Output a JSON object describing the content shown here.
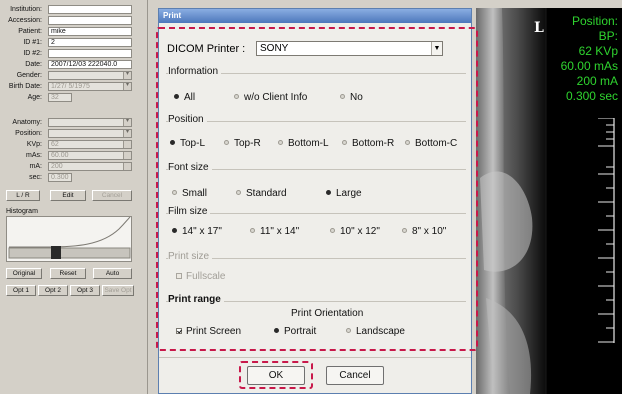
{
  "patient_panel": {
    "fields": [
      {
        "label": "Institution:",
        "value": ""
      },
      {
        "label": "Accession:",
        "value": ""
      },
      {
        "label": "Patient:",
        "value": "mike"
      },
      {
        "label": "ID #1:",
        "value": "2"
      },
      {
        "label": "ID #2:",
        "value": ""
      },
      {
        "label": "Date:",
        "value": "2007/12/03 222040.0"
      },
      {
        "label": "Gender:",
        "value": ""
      },
      {
        "label": "Birth Date:",
        "value": "1/27/ 5/1975"
      },
      {
        "label": "Age:",
        "value": "32"
      },
      {
        "label": "Anatomy:",
        "value": ""
      },
      {
        "label": "Position:",
        "value": ""
      },
      {
        "label": "KVp:",
        "value": "62"
      },
      {
        "label": "mAs:",
        "value": "60.00"
      },
      {
        "label": "mA:",
        "value": "200"
      },
      {
        "label": "sec:",
        "value": "0.300"
      }
    ],
    "buttons_row1": [
      "L / R",
      "Edit",
      "Cancel"
    ],
    "histogram_label": "Histogram",
    "buttons_row2": [
      "Original",
      "Reset",
      "Auto"
    ],
    "buttons_row3": [
      "Opt 1",
      "Opt 2",
      "Opt 3",
      "Save Opt"
    ]
  },
  "image_overlay": {
    "orientation_marker": "L",
    "lines": [
      "Position:",
      "BP:",
      "62 KVp",
      "60.00 mAs",
      "200 mA",
      "0.300 sec"
    ],
    "text_color": "#2fd42f"
  },
  "dialog": {
    "title": "Print",
    "printer_label": "DICOM Printer :",
    "printer_value": "SONY",
    "information": {
      "title": "Information",
      "options": [
        "All",
        "w/o Client Info",
        "No"
      ],
      "selected": "All"
    },
    "position": {
      "title": "Position",
      "options": [
        "Top-L",
        "Top-R",
        "Bottom-L",
        "Bottom-R",
        "Bottom-C"
      ],
      "selected": "Top-L"
    },
    "font_size": {
      "title": "Font size",
      "options": [
        "Small",
        "Standard",
        "Large"
      ],
      "selected": "Large"
    },
    "film_size": {
      "title": "Film size",
      "options": [
        "14\" x 17\"",
        "11\" x 14\"",
        "10\" x 12\"",
        "8\" x 10\""
      ],
      "selected": "14\" x 17\""
    },
    "print_size": {
      "title": "Print size",
      "checkbox": "Fullscale",
      "enabled": false
    },
    "print_range": {
      "title": "Print range",
      "checkbox": "Print Screen",
      "checked": true
    },
    "print_orientation": {
      "title": "Print Orientation",
      "options": [
        "Portrait",
        "Landscape"
      ],
      "selected": "Portrait"
    },
    "ok_label": "OK",
    "cancel_label": "Cancel"
  },
  "colors": {
    "highlight_dash": "#c8184a",
    "titlebar": "#4d77bb"
  }
}
